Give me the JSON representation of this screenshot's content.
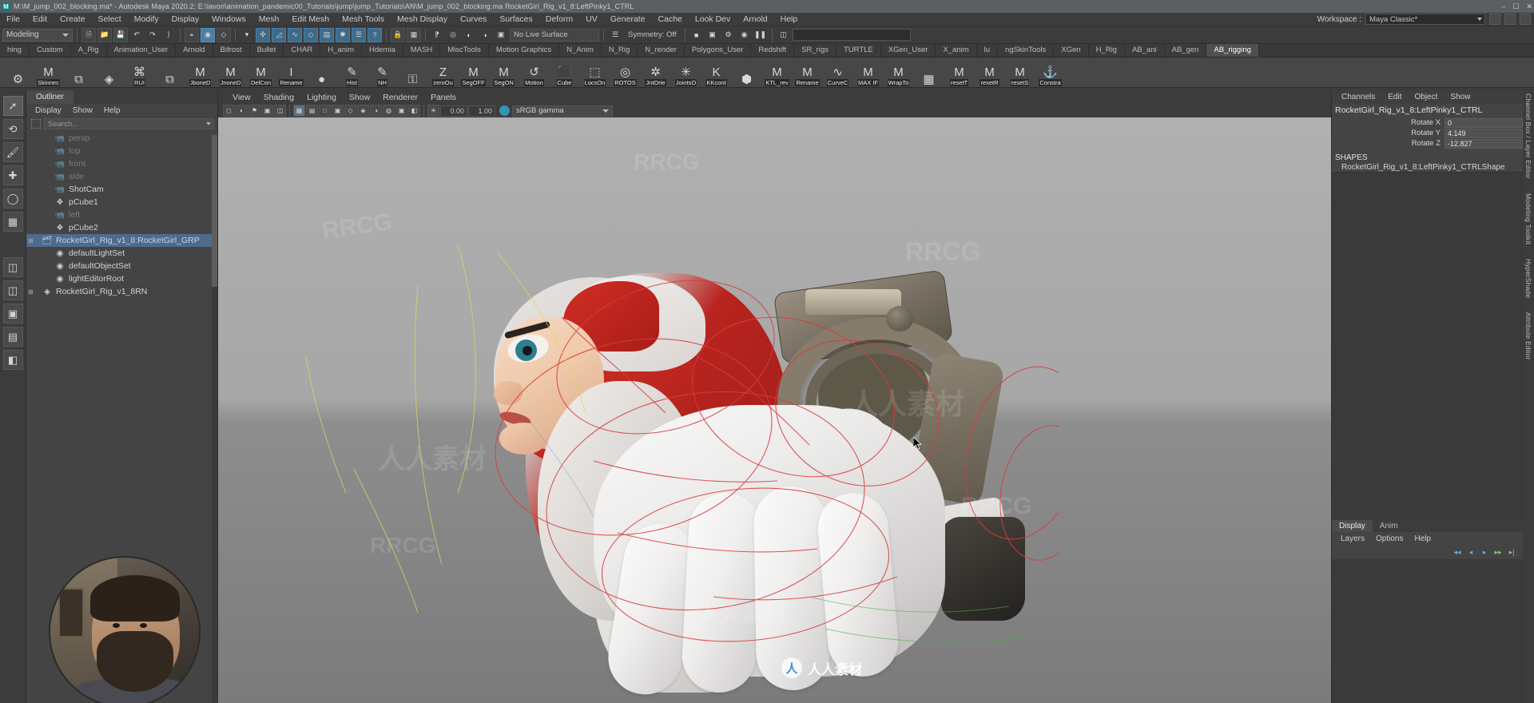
{
  "titlebar": {
    "app_icon": "maya-logo",
    "text": "M:\\M_jump_002_blocking.ma* - Autodesk Maya 2020.2: E:\\lavori\\animation_pandemic00_Tutorials\\jump\\jump_Tutorials\\AN\\M_jump_002_blocking.ma      RocketGirl_Rig_v1_8:LeftPinky1_CTRL",
    "minimize": "–",
    "maximize": "☐",
    "close": "✕"
  },
  "menubar": {
    "items": [
      "File",
      "Edit",
      "Create",
      "Select",
      "Modify",
      "Display",
      "Windows",
      "Mesh",
      "Edit Mesh",
      "Mesh Tools",
      "Mesh Display",
      "Curves",
      "Surfaces",
      "Deform",
      "UV",
      "Generate",
      "Cache",
      "Look Dev",
      "Arnold",
      "Help"
    ],
    "workspace_label": "Workspace :",
    "workspace_value": "Maya Classic*"
  },
  "statusbar": {
    "mode": "Modeling",
    "live_surface": "No Live Surface",
    "symmetry": "Symmetry: Off",
    "search_placeholder": ""
  },
  "shelf": {
    "tabs": [
      "hing",
      "Custom",
      "A_Rig",
      "Animation_User",
      "Arnold",
      "Bifrost",
      "Bullet",
      "CHAR",
      "H_anim",
      "Hdemia",
      "MASH",
      "MiscTools",
      "Motion Graphics",
      "N_Anim",
      "N_Rig",
      "N_render",
      "Polygons_User",
      "Redshift",
      "SR_rigs",
      "TURTLE",
      "XGen_User",
      "X_anim",
      "lu",
      "ngSkinTools",
      "XGen",
      "H_Rig",
      "AB_ani",
      "AB_gen",
      "AB_rigging"
    ],
    "active_tab": "AB_rigging",
    "items": [
      {
        "label": "",
        "glyph": "⚙"
      },
      {
        "label": "Skinnec",
        "glyph": "M"
      },
      {
        "label": "",
        "glyph": "⧉"
      },
      {
        "label": "",
        "glyph": "◈"
      },
      {
        "label": "RUI",
        "glyph": "⌘"
      },
      {
        "label": "",
        "glyph": "⧉"
      },
      {
        "label": "JboneD",
        "glyph": "M"
      },
      {
        "label": "JnoneD",
        "glyph": "M"
      },
      {
        "label": "DelCon",
        "glyph": "M"
      },
      {
        "label": "Rename",
        "glyph": "I"
      },
      {
        "label": "",
        "glyph": "●"
      },
      {
        "label": "Hist",
        "glyph": "✎"
      },
      {
        "label": "NH",
        "glyph": "✎"
      },
      {
        "label": "",
        "glyph": "⚿"
      },
      {
        "label": "zeroOu",
        "glyph": "Z"
      },
      {
        "label": "SegOFF",
        "glyph": "M"
      },
      {
        "label": "SegON",
        "glyph": "M"
      },
      {
        "label": "Motion",
        "glyph": "↺"
      },
      {
        "label": "Cube",
        "glyph": "⬛"
      },
      {
        "label": "LocsOn",
        "glyph": "⬚"
      },
      {
        "label": "ROTOS",
        "glyph": "◎"
      },
      {
        "label": "JntOrie",
        "glyph": "✲"
      },
      {
        "label": "JointsO",
        "glyph": "✳"
      },
      {
        "label": "KKcont",
        "glyph": "K"
      },
      {
        "label": "",
        "glyph": "⬢"
      },
      {
        "label": "KTL_rev",
        "glyph": "M"
      },
      {
        "label": "Rename",
        "glyph": "M"
      },
      {
        "label": "CurveC",
        "glyph": "∿"
      },
      {
        "label": "MAX IF",
        "glyph": "M"
      },
      {
        "label": "WrapTo",
        "glyph": "M"
      },
      {
        "label": "",
        "glyph": "▦"
      },
      {
        "label": "resetT",
        "glyph": "M"
      },
      {
        "label": "resetR",
        "glyph": "M"
      },
      {
        "label": "resetS",
        "glyph": "M"
      },
      {
        "label": "Constra",
        "glyph": "⚓"
      }
    ]
  },
  "toolbox": {
    "tools": [
      "select-tool",
      "lasso-tool",
      "paint-select-tool",
      "move-tool",
      "rotate-tool",
      "scale-tool",
      "last-tool",
      "layout-single",
      "layout-two-panes",
      "layout-four-panes",
      "layout-persp-outliner",
      "layout-hypergraph"
    ]
  },
  "outliner": {
    "tab": "Outliner",
    "menus": [
      "Display",
      "Show",
      "Help"
    ],
    "search_placeholder": "Search...",
    "rows": [
      {
        "label": "persp",
        "icon": "camera-icon",
        "dim": true,
        "expand": "",
        "indent": 1
      },
      {
        "label": "top",
        "icon": "camera-icon",
        "dim": true,
        "expand": "",
        "indent": 1
      },
      {
        "label": "front",
        "icon": "camera-icon",
        "dim": true,
        "expand": "",
        "indent": 1
      },
      {
        "label": "side",
        "icon": "camera-icon",
        "dim": true,
        "expand": "",
        "indent": 1
      },
      {
        "label": "ShotCam",
        "icon": "camera-icon",
        "dim": false,
        "expand": "",
        "indent": 1
      },
      {
        "label": "pCube1",
        "icon": "mesh-icon",
        "dim": false,
        "expand": "",
        "indent": 1
      },
      {
        "label": "left",
        "icon": "camera-icon",
        "dim": true,
        "expand": "",
        "indent": 1
      },
      {
        "label": "pCube2",
        "icon": "mesh-icon",
        "dim": false,
        "expand": "",
        "indent": 1
      },
      {
        "label": "RocketGirl_Rig_v1_8:RocketGirl_GRP",
        "icon": "group-icon",
        "dim": false,
        "expand": "⊞",
        "indent": 0,
        "selected": true
      },
      {
        "label": "defaultLightSet",
        "icon": "set-icon",
        "dim": false,
        "expand": "",
        "indent": 1
      },
      {
        "label": "defaultObjectSet",
        "icon": "set-icon",
        "dim": false,
        "expand": "",
        "indent": 1
      },
      {
        "label": "lightEditorRoot",
        "icon": "set-icon",
        "dim": false,
        "expand": "",
        "indent": 1
      },
      {
        "label": "RocketGirl_Rig_v1_8RN",
        "icon": "reference-icon",
        "dim": false,
        "expand": "⊞",
        "indent": 0
      }
    ]
  },
  "viewport": {
    "menus": [
      "View",
      "Shading",
      "Lighting",
      "Show",
      "Renderer",
      "Panels"
    ],
    "exposure_value": "0.00",
    "gamma_value": "1.00",
    "color_space": "sRGB gamma"
  },
  "channelbox": {
    "menus": [
      "Channels",
      "Edit",
      "Object",
      "Show"
    ],
    "object_name": "RocketGirl_Rig_v1_8:LeftPinky1_CTRL",
    "attributes": [
      {
        "name": "Rotate X",
        "value": "0"
      },
      {
        "name": "Rotate Y",
        "value": "4.149"
      },
      {
        "name": "Rotate Z",
        "value": "-12.827"
      }
    ],
    "shapes_header": "SHAPES",
    "shape_name": "RocketGirl_Rig_v1_8:LeftPinky1_CTRLShape",
    "bottom_tabs": [
      "Display",
      "Anim"
    ],
    "bottom_tab_active": "Display",
    "bottom_menus": [
      "Layers",
      "Options",
      "Help"
    ]
  },
  "right_tabs": [
    "Channel Box / Layer Editor",
    "Modeling Toolkit",
    "HyperShade",
    "Attribute Editor"
  ],
  "watermarks": {
    "brand": "RRCG",
    "chinese": "人人素材",
    "logo_letter": "人",
    "logo_text": "人人素材"
  }
}
